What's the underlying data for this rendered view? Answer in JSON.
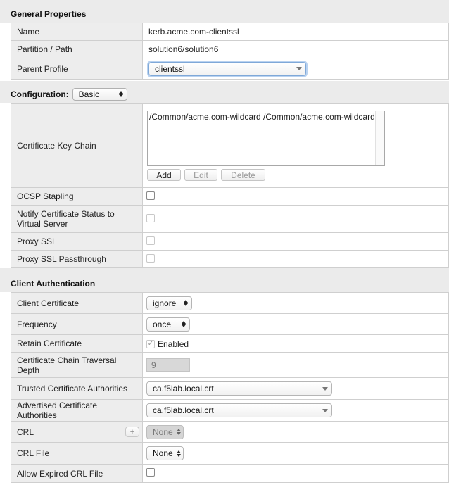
{
  "general": {
    "header": "General Properties",
    "name_label": "Name",
    "name_value": "kerb.acme.com-clientssl",
    "partition_label": "Partition / Path",
    "partition_value": "solution6/solution6",
    "parent_label": "Parent Profile",
    "parent_value": "clientssl"
  },
  "configuration": {
    "header": "Configuration:",
    "mode": "Basic",
    "cert_key_chain_label": "Certificate Key Chain",
    "cert_key_chain_items": [
      "/Common/acme.com-wildcard /Common/acme.com-wildcard"
    ],
    "add_label": "Add",
    "edit_label": "Edit",
    "delete_label": "Delete",
    "ocsp_label": "OCSP Stapling",
    "notify_label_1": "Notify Certificate Status to",
    "notify_label_2": "Virtual Server",
    "proxy_ssl_label": "Proxy SSL",
    "proxy_passthrough_label": "Proxy SSL Passthrough"
  },
  "client_auth": {
    "header": "Client Authentication",
    "client_cert_label": "Client Certificate",
    "client_cert_value": "ignore",
    "frequency_label": "Frequency",
    "frequency_value": "once",
    "retain_label": "Retain Certificate",
    "retain_value": "Enabled",
    "chain_depth_label_1": "Certificate Chain Traversal",
    "chain_depth_label_2": "Depth",
    "chain_depth_value": "9",
    "trusted_ca_label": "Trusted Certificate Authorities",
    "trusted_ca_value": "ca.f5lab.local.crt",
    "advertised_ca_label": "Advertised Certificate Authorities",
    "advertised_ca_value": "ca.f5lab.local.crt",
    "crl_label": "CRL",
    "crl_plus": "+",
    "crl_value": "None",
    "crl_file_label": "CRL File",
    "crl_file_value": "None",
    "allow_expired_label": "Allow Expired CRL File"
  }
}
